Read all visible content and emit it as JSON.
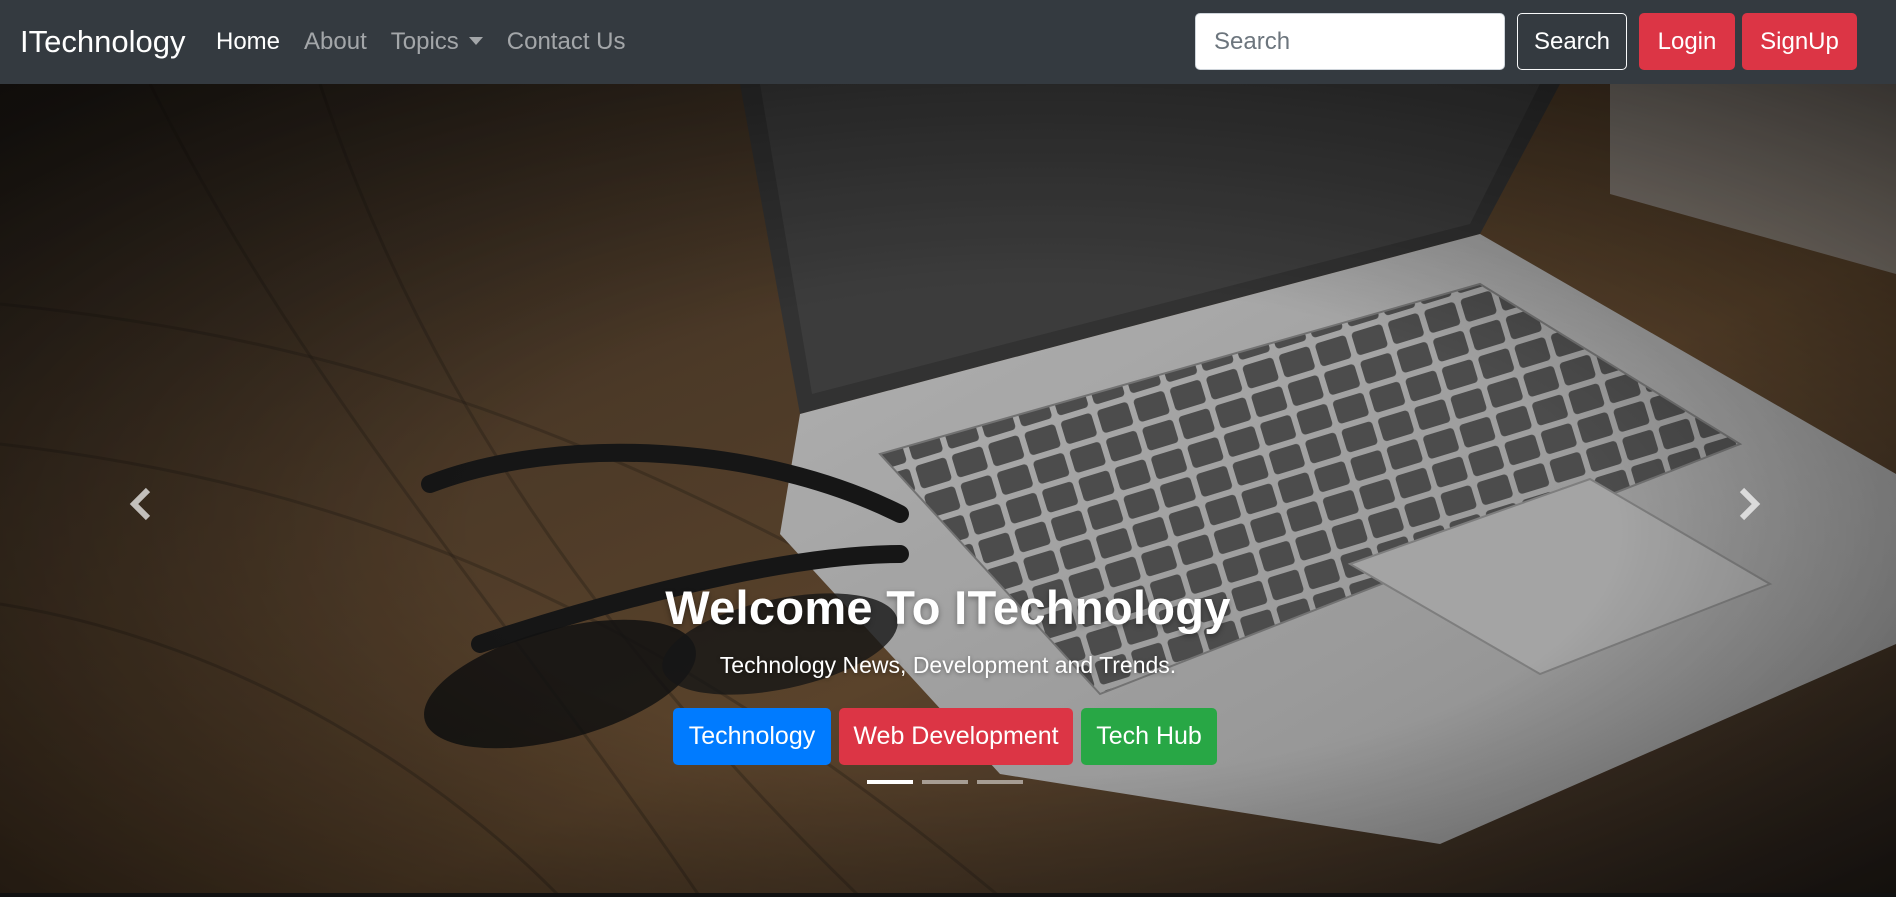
{
  "navbar": {
    "brand": "ITechnology",
    "links": [
      {
        "label": "Home",
        "active": true
      },
      {
        "label": "About",
        "active": false
      },
      {
        "label": "Topics",
        "active": false,
        "dropdown": true
      },
      {
        "label": "Contact Us",
        "active": false
      }
    ],
    "search_placeholder": "Search",
    "search_button": "Search",
    "login_button": "Login",
    "signup_button": "SignUp"
  },
  "carousel": {
    "title": "Welcome To ITechnology",
    "subtitle": "Technology News, Development and Trends.",
    "buttons": [
      {
        "label": "Technology",
        "color": "#007bff"
      },
      {
        "label": "Web Development",
        "color": "#dc3545"
      },
      {
        "label": "Tech Hub",
        "color": "#28a745"
      }
    ],
    "slide_count": 3,
    "active_slide": 1,
    "prev_icon": "chevron-left-icon",
    "next_icon": "chevron-right-icon"
  },
  "colors": {
    "navbar_bg": "#343a40",
    "danger": "#dc3545",
    "primary": "#007bff",
    "success": "#28a745"
  }
}
